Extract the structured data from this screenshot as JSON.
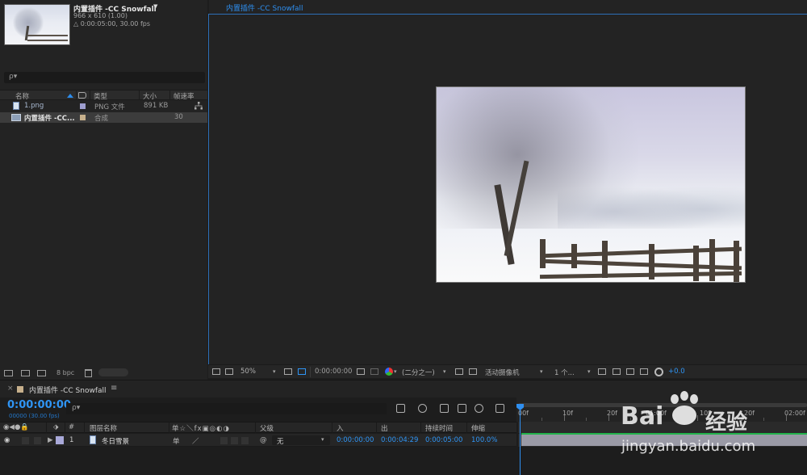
{
  "project": {
    "comp_title": "内置插件 -CC Snowfall",
    "comp_size": "966 x 610 (1.00)",
    "comp_duration": "△ 0:00:05:00, 30.00 fps",
    "search_placeholder": "ρ▾",
    "columns": [
      "名称",
      "类型",
      "大小",
      "帧速率"
    ],
    "items": [
      {
        "name": "1.png",
        "type": "PNG 文件",
        "size": "891 KB",
        "fps": "",
        "swatch": "#9f9fd0",
        "icon": "png-file-icon"
      },
      {
        "name": "内置插件 -CC...",
        "type": "合成",
        "size": "",
        "fps": "30",
        "swatch": "#c7b08c",
        "icon": "composition-icon"
      }
    ],
    "bit_depth": "8 bpc"
  },
  "viewer": {
    "tab_label": "内置插件 -CC Snowfall",
    "zoom": "50%",
    "timecode": "0:00:00:00",
    "resolution": "(二分之一)",
    "camera": "活动摄像机",
    "views": "1 个...",
    "exposure": "+0.0"
  },
  "timeline": {
    "tab_title": "内置插件 -CC Snowfall",
    "menu_icon": "≡",
    "timecode": "0:00:00:00",
    "frames_fps": "00000 (30.00 fps)",
    "search_placeholder": "ρ▾",
    "col_number": "#",
    "col_layer_name": "图层名称",
    "col_switches": "单☆＼fx▣◎◐◑",
    "col_parent": "父级",
    "col_in": "入",
    "col_out": "出",
    "col_duration": "持续时间",
    "col_stretch": "伸缩",
    "layer": {
      "number": "1",
      "name": "冬日雪景",
      "switch": "单",
      "parent": "无",
      "in": "0:00:00:00",
      "out": "0:00:04:29",
      "duration": "0:00:05:00",
      "stretch": "100.0%",
      "label_color": "#a9a9d9"
    },
    "ruler_labels": [
      "00f",
      "10f",
      "20f",
      "01:00f",
      "10f",
      "20f",
      "02:00f"
    ]
  },
  "watermark": {
    "brand": "Bai",
    "brand_suffix": "经验",
    "url": "jingyan.baidu.com"
  },
  "colors": {
    "accent_blue": "#2f95f5",
    "panel_bg": "#232323",
    "track_green": "#22b34b"
  }
}
